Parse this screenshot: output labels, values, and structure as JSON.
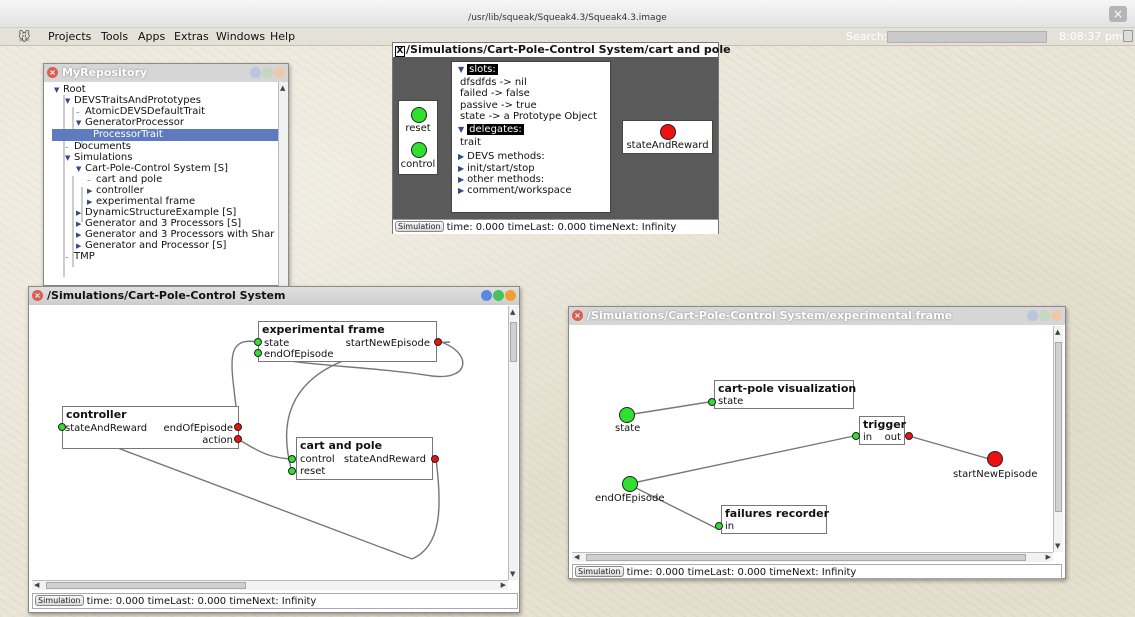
{
  "os": {
    "title": "/usr/lib/squeak/Squeak4.3/Squeak4.3.image",
    "close_glyph": "×"
  },
  "menubar": {
    "items": [
      "Projects",
      "Tools",
      "Apps",
      "Extras",
      "Windows",
      "Help"
    ],
    "search_label": "Search:",
    "clock": "8:08:37 pm"
  },
  "repository": {
    "title": "MyRepository",
    "tree": [
      {
        "label": "Root",
        "expanded": true
      },
      {
        "label": "DEVSTraitsAndPrototypes",
        "expanded": true
      },
      {
        "label": "AtomicDEVSDefaultTrait"
      },
      {
        "label": "GeneratorProcessor",
        "expanded": true
      },
      {
        "label": "ProcessorTrait",
        "selected": true
      },
      {
        "label": "Documents"
      },
      {
        "label": "Simulations",
        "expanded": true
      },
      {
        "label": "Cart-Pole-Control System [S]",
        "expanded": true
      },
      {
        "label": "cart and pole"
      },
      {
        "label": "controller",
        "collapsed": true
      },
      {
        "label": "experimental frame",
        "collapsed": true
      },
      {
        "label": "DynamicStructureExample [S]",
        "collapsed": true
      },
      {
        "label": "Generator and 3 Processors [S]",
        "collapsed": true
      },
      {
        "label": "Generator and 3 Processors with Shar",
        "collapsed": true
      },
      {
        "label": "Generator and Processor [S]",
        "collapsed": true
      },
      {
        "label": "TMP"
      }
    ]
  },
  "inspector": {
    "title": "/Simulations/Cart-Pole-Control System/cart and pole",
    "close_glyph": "X",
    "inputs": [
      "reset",
      "control"
    ],
    "output": "stateAndReward",
    "slots_header": "slots:",
    "slots": [
      "dfsdfds -> nil",
      "failed -> false",
      "passive -> true",
      "state -> a Prototype Object"
    ],
    "delegates_header": "delegates:",
    "delegates": [
      "trait"
    ],
    "sections": [
      "DEVS methods:",
      "init/start/stop",
      "other methods:",
      "comment/workspace"
    ],
    "status": {
      "button": "Simulation",
      "text": "time: 0.000 timeLast: 0.000 timeNext: Infinity"
    }
  },
  "system_window": {
    "title": "/Simulations/Cart-Pole-Control System",
    "blocks": {
      "experimental_frame": {
        "title": "experimental frame",
        "in": [
          "state",
          "endOfEpisode"
        ],
        "out": [
          "startNewEpisode"
        ]
      },
      "controller": {
        "title": "controller",
        "in": [
          "stateAndReward"
        ],
        "out": [
          "endOfEpisode",
          "action"
        ]
      },
      "cart_and_pole": {
        "title": "cart and pole",
        "in": [
          "control",
          "reset"
        ],
        "out": [
          "stateAndReward"
        ]
      }
    },
    "status": {
      "button": "Simulation",
      "text": "time: 0.000 timeLast: 0.000 timeNext: Infinity"
    }
  },
  "ef_window": {
    "title": "/Simulations/Cart-Pole-Control System/experimental frame",
    "inputs": [
      "state",
      "endOfEpisode"
    ],
    "output": "startNewEpisode",
    "blocks": {
      "visualization": {
        "title": "cart-pole visualization",
        "in": [
          "state"
        ]
      },
      "trigger": {
        "title": "trigger",
        "in": [
          "in"
        ],
        "out": [
          "out"
        ]
      },
      "recorder": {
        "title": "failures recorder",
        "in": [
          "in"
        ]
      }
    },
    "status": {
      "button": "Simulation",
      "text": "time: 0.000 timeLast: 0.000 timeNext: Infinity"
    }
  },
  "colors": {
    "port_green": "#2fe02f",
    "port_red": "#ee1111",
    "selection": "#5f7bbf",
    "inspector_bg": "#5a5a5a"
  }
}
